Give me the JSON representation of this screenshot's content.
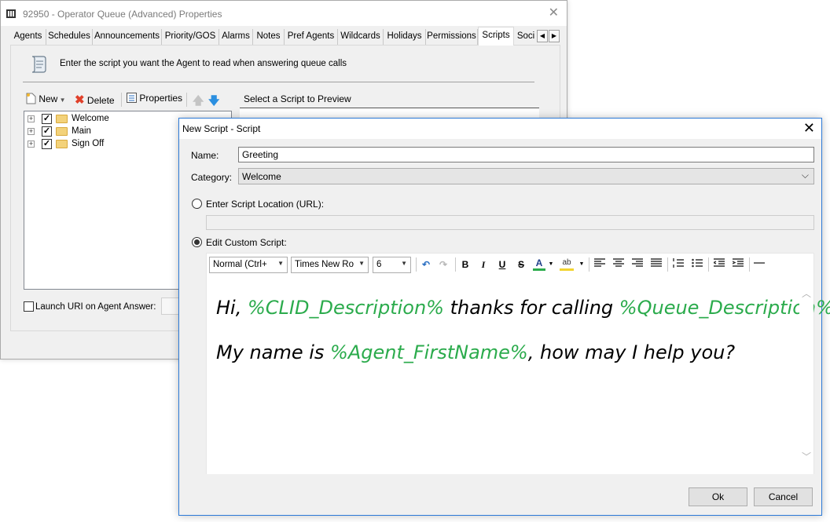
{
  "back_window": {
    "title": "92950 - Operator Queue (Advanced) Properties",
    "tabs": [
      "Agents",
      "Schedules",
      "Announcements",
      "Priority/GOS",
      "Alarms",
      "Notes",
      "Pref Agents",
      "Wildcards",
      "Holidays",
      "Permissions",
      "Scripts",
      "Soci"
    ],
    "active_tab": "Scripts",
    "instruction": "Enter the script you want the Agent to read when answering queue calls",
    "toolbar": {
      "new": "New",
      "delete": "Delete",
      "properties": "Properties"
    },
    "tree": [
      {
        "label": "Welcome",
        "checked": true
      },
      {
        "label": "Main",
        "checked": true
      },
      {
        "label": "Sign Off",
        "checked": true
      }
    ],
    "preview_label": "Select a Script to Preview",
    "launch_label": "Launch URI on Agent Answer:"
  },
  "dialog": {
    "title": "New Script - Script",
    "name_label": "Name:",
    "name_value": "Greeting",
    "category_label": "Category:",
    "category_value": "Welcome",
    "url_radio_label": "Enter Script Location (URL):",
    "custom_radio_label": "Edit Custom Script:",
    "selected_mode": "custom",
    "editor_toolbar": {
      "style": "Normal (Ctrl+",
      "font": "Times New Ro",
      "size": "6"
    },
    "script": {
      "line1": {
        "t1": "Hi, ",
        "v1": "%CLID_Description%",
        "t2": " thanks for calling ",
        "v2": "%Queue_Description%",
        "t3": "."
      },
      "line2": {
        "t1": "My name is ",
        "v1": "%Agent_FirstName%",
        "t2": ", how may I help you?"
      }
    },
    "ok_label": "Ok",
    "cancel_label": "Cancel"
  },
  "colors": {
    "variable": "#2bab4c",
    "dialog_border": "#2b79d7",
    "delete_icon": "#e0402a",
    "down_arrow": "#2b8fe0"
  }
}
